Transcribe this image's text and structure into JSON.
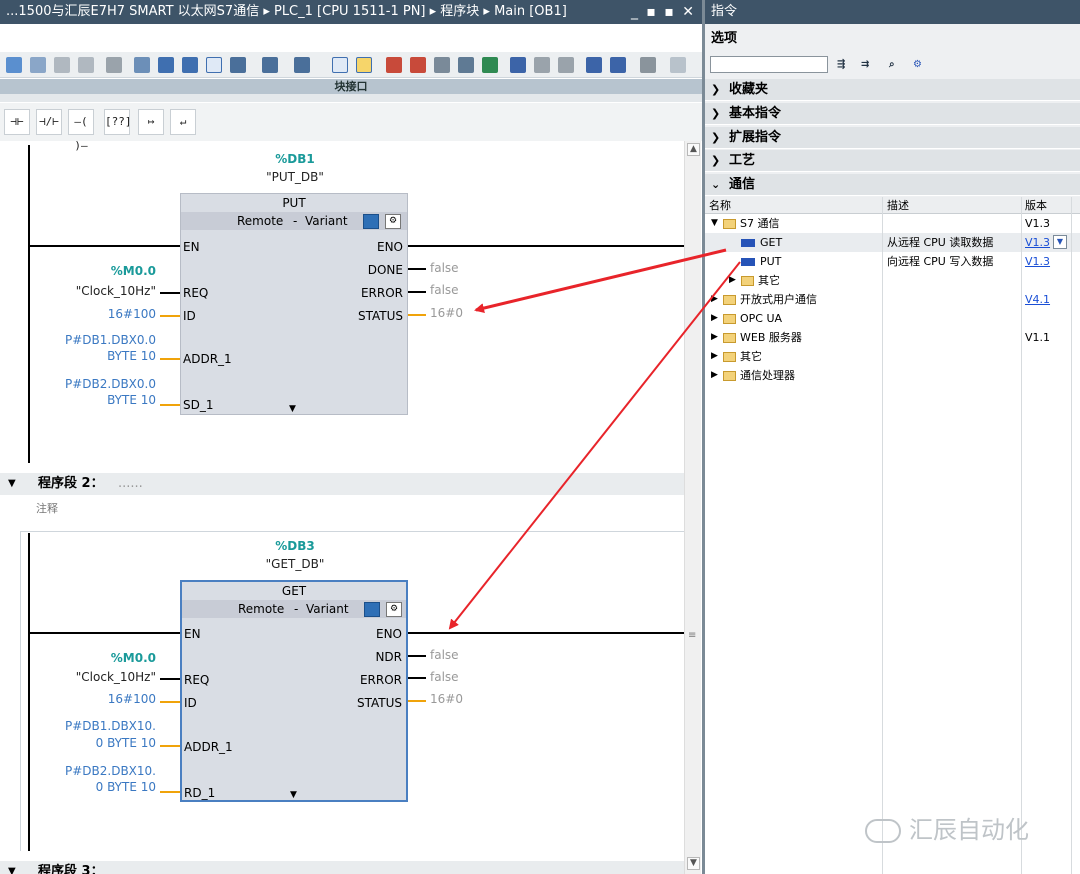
{
  "editor": {
    "title": "...1500与汇辰E7H7 SMART 以太网S7通信 ▸ PLC_1 [CPU 1511-1 PN] ▸ 程序块 ▸ Main [OB1]",
    "window_controls": "_ ▪ ▪ ✕",
    "block_interface": "块接口",
    "ladder_buttons": [
      "⊣⊢",
      "⊣/⊢",
      "–( )–",
      "[??]",
      "↦",
      "↵"
    ],
    "network1": {
      "db_addr": "%DB1",
      "db_name": "\"PUT_DB\"",
      "block": {
        "name": "PUT",
        "remote": "Remote",
        "dash": "-",
        "variant": "Variant",
        "in_pins": [
          "EN",
          "REQ",
          "ID",
          "ADDR_1",
          "SD_1"
        ],
        "out_pins": [
          "ENO",
          "DONE",
          "ERROR",
          "STATUS"
        ]
      },
      "req_addr": "%M0.0",
      "req_name": "\"Clock_10Hz\"",
      "id_val": "16#100",
      "addr1_line1": "P#DB1.DBX0.0",
      "addr1_line2": "BYTE 10",
      "sd1_line1": "P#DB2.DBX0.0",
      "sd1_line2": "BYTE 10",
      "done_val": "false",
      "error_val": "false",
      "status_val": "16#0"
    },
    "network2_header": {
      "label": "程序段 2：",
      "dots": "......",
      "comment": "注释"
    },
    "network2": {
      "db_addr": "%DB3",
      "db_name": "\"GET_DB\"",
      "block": {
        "name": "GET",
        "remote": "Remote",
        "dash": "-",
        "variant": "Variant",
        "in_pins": [
          "EN",
          "REQ",
          "ID",
          "ADDR_1",
          "RD_1"
        ],
        "out_pins": [
          "ENO",
          "NDR",
          "ERROR",
          "STATUS"
        ]
      },
      "req_addr": "%M0.0",
      "req_name": "\"Clock_10Hz\"",
      "id_val": "16#100",
      "addr1_line1": "P#DB1.DBX10.",
      "addr1_line2": "0 BYTE 10",
      "rd1_line1": "P#DB2.DBX10.",
      "rd1_line2": "0 BYTE 10",
      "ndr_val": "false",
      "error_val": "false",
      "status_val": "16#0"
    },
    "network3_header": {
      "label": "程序段 3："
    }
  },
  "instructions": {
    "title": "指令",
    "options": "选项",
    "search_placeholder": "",
    "sections": [
      {
        "label": "收藏夹",
        "expanded": false
      },
      {
        "label": "基本指令",
        "expanded": false
      },
      {
        "label": "扩展指令",
        "expanded": false
      },
      {
        "label": "工艺",
        "expanded": false
      },
      {
        "label": "通信",
        "expanded": true
      }
    ],
    "columns": {
      "name": "名称",
      "desc": "描述",
      "version": "版本"
    },
    "tree": [
      {
        "name": "S7 通信",
        "desc": "",
        "version": "V1.3",
        "type": "folder",
        "expanded": true,
        "level": 0
      },
      {
        "name": "GET",
        "desc": "从远程 CPU 读取数据",
        "version": "V1.3",
        "type": "block",
        "level": 1
      },
      {
        "name": "PUT",
        "desc": "向远程 CPU 写入数据",
        "version": "V1.3",
        "type": "block",
        "level": 1
      },
      {
        "name": "其它",
        "desc": "",
        "version": "",
        "type": "folder",
        "level": 1
      },
      {
        "name": "开放式用户通信",
        "desc": "",
        "version": "V4.1",
        "type": "folder",
        "level": 0
      },
      {
        "name": "OPC UA",
        "desc": "",
        "version": "",
        "type": "folder",
        "level": 0
      },
      {
        "name": "WEB 服务器",
        "desc": "",
        "version": "V1.1",
        "type": "folder",
        "level": 0
      },
      {
        "name": "其它",
        "desc": "",
        "version": "",
        "type": "folder",
        "level": 0
      },
      {
        "name": "通信处理器",
        "desc": "",
        "version": "",
        "type": "folder",
        "level": 0
      }
    ]
  },
  "watermark": "汇辰自动化",
  "colors": {
    "title_bar": "#3e5468",
    "annotation_arrow": "#e8242a",
    "teal_address": "#1a9a9a",
    "operand_blue": "#3a78c2",
    "wire_orange": "#f0a30a"
  }
}
